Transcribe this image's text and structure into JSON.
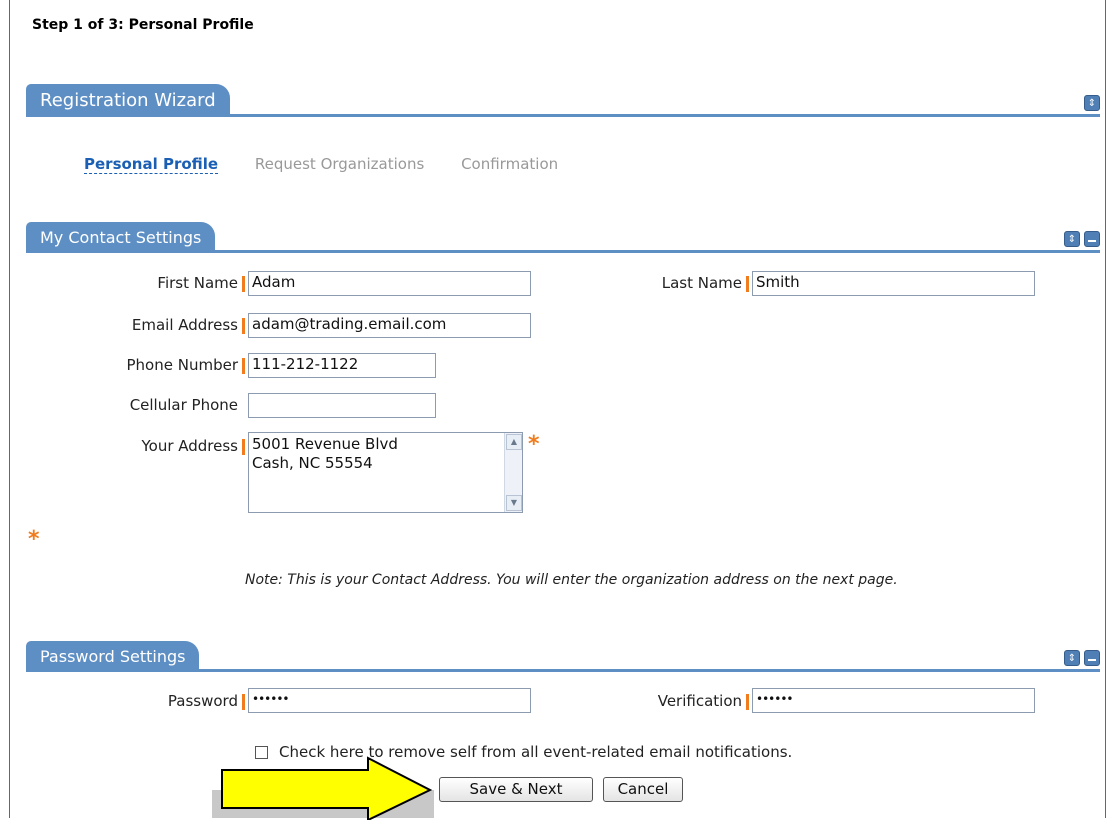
{
  "step_title": "Step 1 of 3: Personal Profile",
  "wizard": {
    "title": "Registration Wizard",
    "steps": [
      "Personal Profile",
      "Request Organizations",
      "Confirmation"
    ],
    "active_step": 0
  },
  "contact": {
    "title": "My Contact Settings",
    "first_name_label": "First Name",
    "first_name": "Adam",
    "last_name_label": "Last Name",
    "last_name": "Smith",
    "email_label": "Email Address",
    "email": "adam@trading.email.com",
    "phone_label": "Phone Number",
    "phone": "111-212-1122",
    "cell_label": "Cellular Phone",
    "cell": "",
    "address_label": "Your Address",
    "address": "5001 Revenue Blvd\nCash, NC 55554",
    "asterisk": "*",
    "note": "Note: This is your Contact Address. You will enter the organization address on the next page."
  },
  "password": {
    "title": "Password Settings",
    "password_label": "Password",
    "password_value": "••••••",
    "verification_label": "Verification",
    "verification_value": "••••••"
  },
  "notifications": {
    "checkbox_label": "Check here to remove self from all event-related email notifications.",
    "checked": false
  },
  "buttons": {
    "save_next": "Save & Next",
    "cancel": "Cancel"
  },
  "colors": {
    "header_blue": "#5e8fc4",
    "required_orange": "#f07c1e",
    "active_link": "#1a5fb4",
    "arrow_fill": "#ffff00"
  },
  "icons": {
    "expand": "expand-collapse-icon",
    "minimize": "minimize-icon",
    "arrow": "pointer-arrow-icon"
  }
}
